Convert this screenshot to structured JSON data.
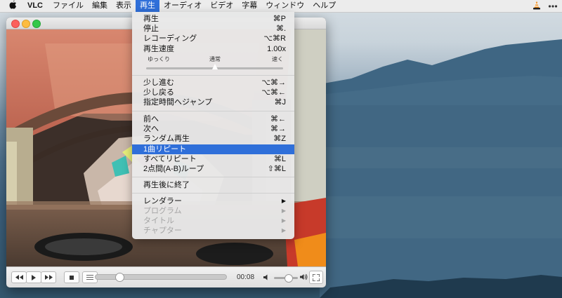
{
  "menubar": {
    "apple": "",
    "app_name": "VLC",
    "items": [
      "ファイル",
      "編集",
      "表示",
      "再生",
      "オーディオ",
      "ビデオ",
      "字幕",
      "ウィンドウ",
      "ヘルプ"
    ],
    "active_item": "再生",
    "status_icons": [
      "vlc-cone-icon",
      "more-icon"
    ]
  },
  "playback_menu": {
    "play": {
      "label": "再生",
      "shortcut": "⌘P"
    },
    "stop": {
      "label": "停止",
      "shortcut": "⌘."
    },
    "record": {
      "label": "レコーディング",
      "shortcut": "⌥⌘R"
    },
    "speed": {
      "label": "再生速度",
      "value": "1.00x",
      "slow_label": "ゆっくり",
      "normal_label": "通常",
      "fast_label": "速く",
      "position_fraction": 0.5
    },
    "step_forward": {
      "label": "少し進む",
      "shortcut": "⌥⌘→"
    },
    "step_backward": {
      "label": "少し戻る",
      "shortcut": "⌥⌘←"
    },
    "jump_to_time": {
      "label": "指定時間へジャンプ",
      "shortcut": "⌘J"
    },
    "previous": {
      "label": "前へ",
      "shortcut": "⌘←"
    },
    "next": {
      "label": "次へ",
      "shortcut": "⌘→"
    },
    "random": {
      "label": "ランダム再生",
      "shortcut": "⌘Z"
    },
    "repeat_one": {
      "label": "1曲リピート",
      "shortcut": ""
    },
    "repeat_all": {
      "label": "すべてリピート",
      "shortcut": "⌘L"
    },
    "ab_loop": {
      "label": "2点間(A-B)ループ",
      "shortcut": "⇧⌘L"
    },
    "quit_after": {
      "label": "再生後に終了"
    },
    "renderer": {
      "label": "レンダラー"
    },
    "program": {
      "label": "プログラム"
    },
    "title": {
      "label": "タイトル"
    },
    "chapter": {
      "label": "チャプター"
    },
    "submenu_arrow": "▶",
    "highlighted_item": "1曲リピート"
  },
  "player": {
    "timecode": "00:08",
    "seek_fraction": 0.16,
    "volume_fraction": 0.6
  },
  "colors": {
    "menu_highlight": "#2f6fd9",
    "close": "#fc605c",
    "minimize": "#fdbc40",
    "zoom": "#34c84a"
  }
}
